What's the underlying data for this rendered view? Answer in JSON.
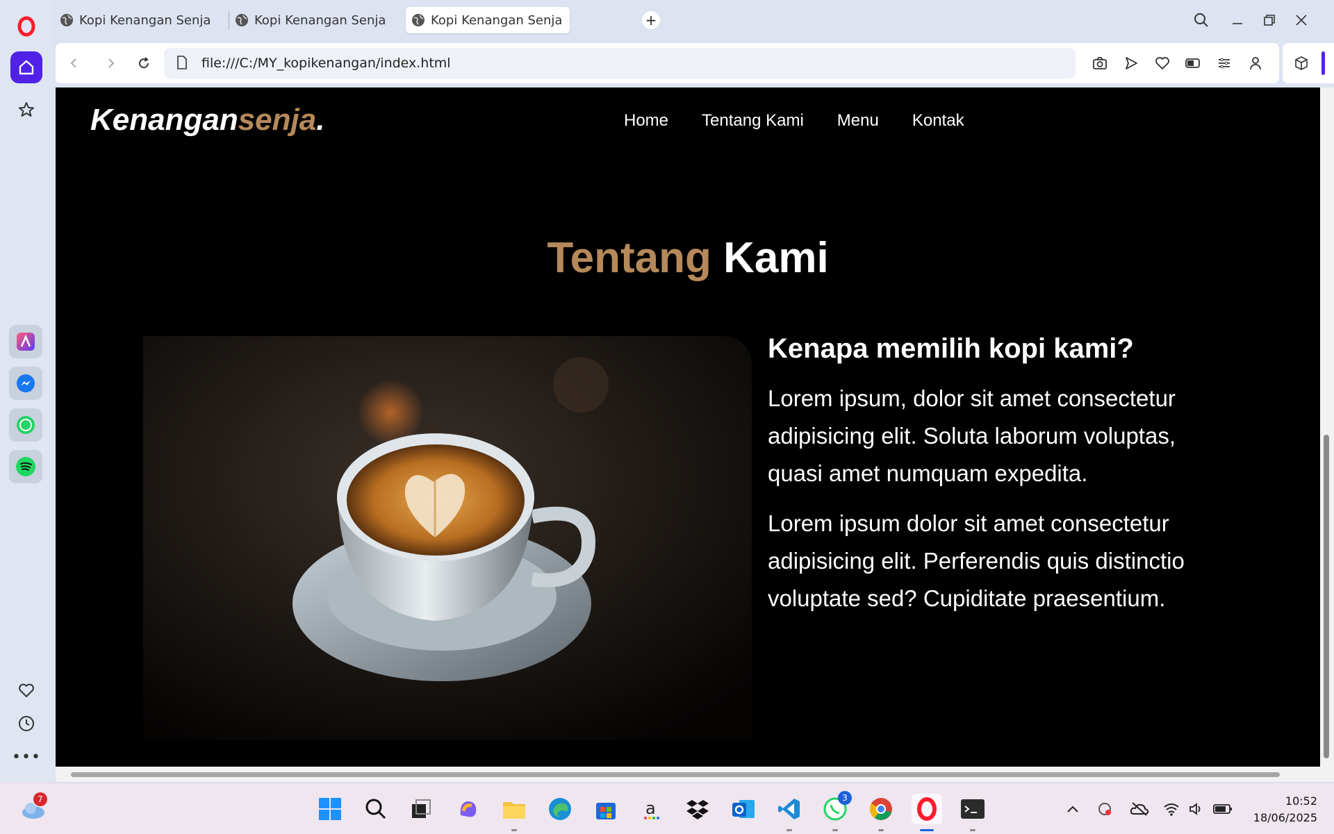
{
  "browser": {
    "tabs": [
      {
        "title": "Kopi Kenangan Senja",
        "active": false
      },
      {
        "title": "Kopi Kenangan Senja",
        "active": false
      },
      {
        "title": "Kopi Kenangan Senja",
        "active": true
      }
    ],
    "url": "file:///C:/MY_kopikenangan/index.html",
    "accent_color": "#5022e8"
  },
  "page": {
    "logo_main": "Kenangan",
    "logo_accent": "senja",
    "logo_dot": ".",
    "nav": [
      "Home",
      "Tentang Kami",
      "Menu",
      "Kontak"
    ],
    "title_accent": "Tentang",
    "title_main": "Kami",
    "heading": "Kenapa memilih kopi kami?",
    "paragraphs": [
      "Lorem ipsum, dolor sit amet consectetur adipisicing elit. Soluta laborum voluptas, quasi amet numquam expedita.",
      "Lorem ipsum dolor sit amet consectetur adipisicing elit. Perferendis quis distinctio voluptate sed? Cupiditate praesentium."
    ],
    "accent_color": "#b6895b"
  },
  "taskbar": {
    "weather_badge": "7",
    "whatsapp_badge": "3",
    "time": "10:52",
    "date": "18/06/2025"
  }
}
